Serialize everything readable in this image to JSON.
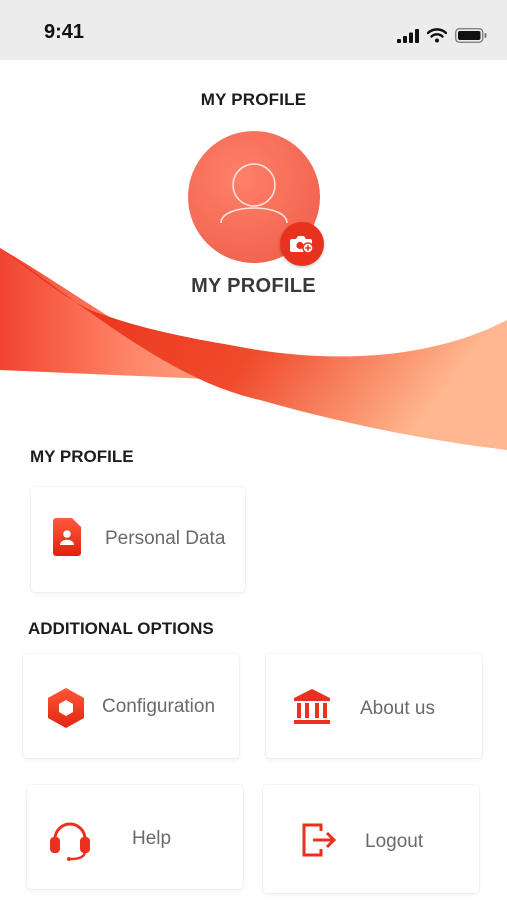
{
  "status_bar": {
    "time": "9:41"
  },
  "header": {
    "title": "MY PROFILE"
  },
  "profile": {
    "name": "MY PROFILE"
  },
  "sections": {
    "profile": {
      "title": "MY PROFILE",
      "items": [
        {
          "label": "Personal Data",
          "icon": "personal-data-icon"
        }
      ]
    },
    "additional": {
      "title": "ADDITIONAL OPTIONS",
      "items": [
        {
          "label": "Configuration",
          "icon": "hexagon-icon"
        },
        {
          "label": "About us",
          "icon": "bank-icon"
        },
        {
          "label": "Help",
          "icon": "headset-icon"
        },
        {
          "label": "Logout",
          "icon": "logout-icon"
        }
      ]
    }
  },
  "colors": {
    "accent": "#e8321f",
    "accent_light": "#ff806a",
    "wave_end": "#ffb38a"
  }
}
